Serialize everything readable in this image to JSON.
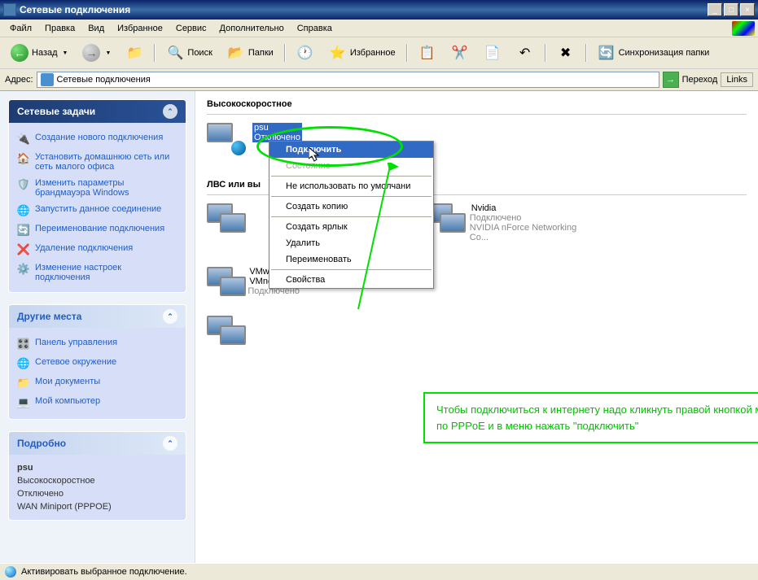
{
  "window": {
    "title": "Сетевые подключения"
  },
  "menu": [
    "Файл",
    "Правка",
    "Вид",
    "Избранное",
    "Сервис",
    "Дополнительно",
    "Справка"
  ],
  "toolbar": {
    "back": "Назад",
    "search": "Поиск",
    "folders": "Папки",
    "favorites": "Избранное",
    "sync": "Синхронизация папки"
  },
  "address": {
    "label": "Адрес:",
    "value": "Сетевые подключения",
    "go": "Переход",
    "links": "Links"
  },
  "sidebar": {
    "tasks": {
      "title": "Сетевые задачи",
      "items": [
        "Создание нового подключения",
        "Установить домашнюю сеть или сеть малого офиса",
        "Изменить параметры брандмауэра Windows",
        "Запустить данное соединение",
        "Переименование подключения",
        "Удаление подключения",
        "Изменение настроек подключения"
      ]
    },
    "places": {
      "title": "Другие места",
      "items": [
        "Панель управления",
        "Сетевое окружение",
        "Мои документы",
        "Мой компьютер"
      ]
    },
    "details": {
      "title": "Подробно",
      "name": "psu",
      "type": "Высокоскоростное",
      "status": "Отключено",
      "device": "WAN Miniport (PPPOE)"
    }
  },
  "main": {
    "section_highspeed": "Высокоскоростное",
    "section_lan": "ЛВС или вы",
    "conn_psu": {
      "name": "psu",
      "status": "Отключено",
      "device": ""
    },
    "conn_nvidia": {
      "name": "Nvidia",
      "status": "Подключено",
      "device": "NVIDIA nForce Networking Co..."
    },
    "conn_vmware": {
      "name": "VMware Network Adapter VMnet1",
      "status": "Подключено",
      "device": ""
    }
  },
  "context_menu": {
    "connect": "Подключить",
    "status": "Состояние",
    "not_default": "Не использовать по умолчани",
    "copy": "Создать копию",
    "shortcut": "Создать ярлык",
    "delete": "Удалить",
    "rename": "Переименовать",
    "properties": "Свойства"
  },
  "annotation": "Чтобы подключиться к интернету надо кликнуть правой кнопкой мыши по иконки подключения по PPPoE и в меню нажать \"подключить\"",
  "statusbar": "Активировать выбранное подключение."
}
